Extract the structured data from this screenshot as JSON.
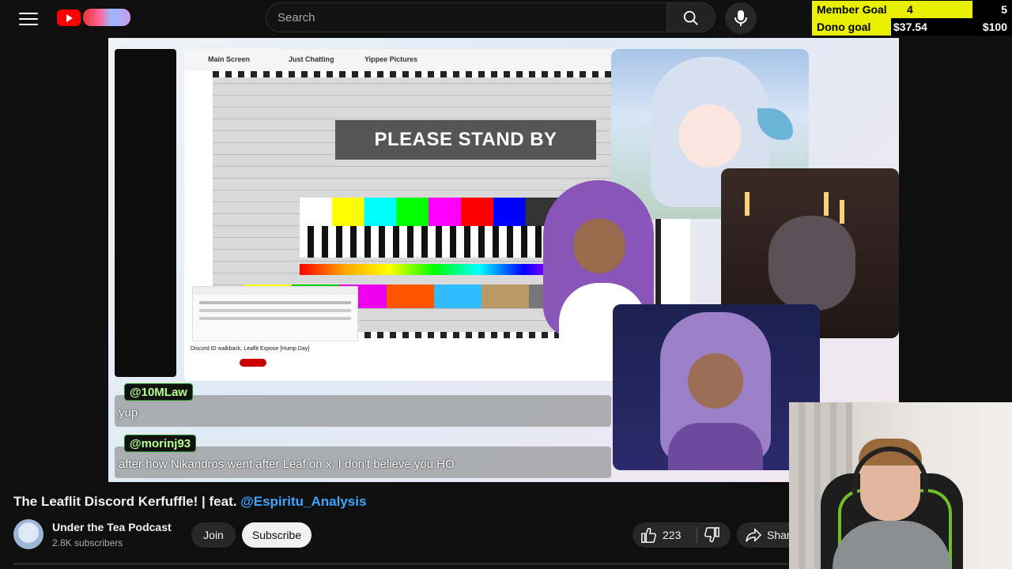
{
  "header": {
    "search_placeholder": "Search"
  },
  "goals": {
    "member": {
      "label": "Member Goal",
      "current": "4",
      "target": "5",
      "progress": 0.8
    },
    "dono": {
      "label": "Dono goal",
      "current": "$37.54",
      "target": "$100",
      "progress": 0.3754
    }
  },
  "stream": {
    "capture_tabs": [
      "Main Screen",
      "Just Chatting",
      "Yippee Pictures"
    ],
    "standby_text": "PLEASE STAND BY",
    "inner_video_title": "Discord ID walkback, Leaflit Expose [Hump Day]"
  },
  "comments": [
    {
      "handle": "@10MLaw",
      "text": "yup"
    },
    {
      "handle": "@morinj93",
      "text": "after how Nikandros went after Leaf on x, I don't believe you HO"
    }
  ],
  "video": {
    "title": "The Leaflit Discord Kerfuffle! | feat. ",
    "title_mention": "@Espiritu_Analysis",
    "channel_name": "Under the Tea Podcast",
    "subscribers": "2.8K subscribers",
    "join_label": "Join",
    "subscribe_label": "Subscribe",
    "likes": "223",
    "share_label": "Share"
  },
  "colors": {
    "accent_link": "#3ea6ff",
    "goal_fill": "#e8f000",
    "youtube_red": "#ff0000"
  },
  "icons": [
    "menu-icon",
    "youtube-logo",
    "search-icon",
    "mic-icon",
    "thumbs-up-icon",
    "thumbs-down-icon",
    "share-icon"
  ]
}
